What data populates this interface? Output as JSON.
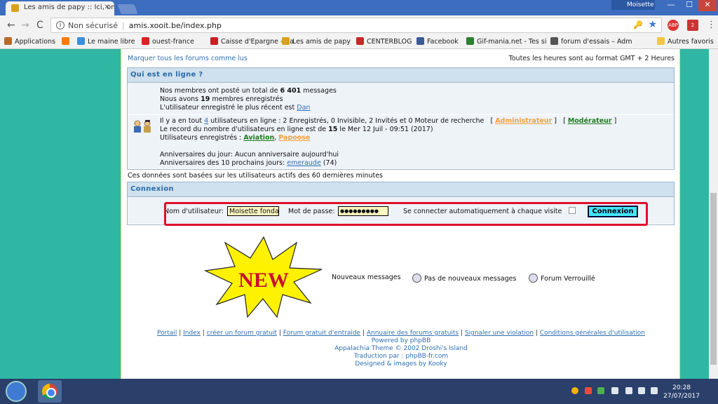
{
  "browser": {
    "tab_title": "Les amis de papy :: Ici, on",
    "tab_close": "✕",
    "profile_name": "Moisette",
    "min_glyph": "—",
    "max_glyph": "☐",
    "close_glyph": "✕",
    "back_glyph": "←",
    "forward_glyph": "→",
    "reload_glyph": "C",
    "security_label": "Non sécurisé",
    "url": "amis.xooit.be/index.php",
    "info_glyph": "i",
    "key_glyph": "🔑",
    "star_glyph": "★",
    "ext1_badge": "ABP",
    "ext2_badge": "2",
    "menu_glyph": "⋮",
    "bookmarks": [
      {
        "label": "Applications",
        "color": "#b86a2a"
      },
      {
        "label": "",
        "color": "#ff7900"
      },
      {
        "label": "Le maine libre",
        "color": "#3a8edc"
      },
      {
        "label": "ouest-france",
        "color": "#d22"
      },
      {
        "label": "Caisse d'Epargne - Ca",
        "color": "#c81d25"
      },
      {
        "label": "Les amis de papy",
        "color": "#d9a21b"
      },
      {
        "label": "CENTERBLOG",
        "color": "#c62828"
      },
      {
        "label": "Facebook",
        "color": "#3b5998"
      },
      {
        "label": "Gif-mania.net - Tes si",
        "color": "#2e7d32"
      },
      {
        "label": "forum d'essais – Adm",
        "color": "#555555"
      }
    ],
    "other_bookmarks": "Autres favoris"
  },
  "forum": {
    "mark_all_read": "Marquer tous les forums comme lus",
    "timezone": "Toutes les heures sont au format GMT + 2 Heures",
    "who_online": {
      "title": "Qui est en ligne ?",
      "stats": {
        "posts_pre": "Nos membres ont posté un total de ",
        "posts_count": "6 401",
        "posts_post": " messages",
        "members_pre": "Nous avons ",
        "members_count": "19",
        "members_post": " membres enregistrés",
        "newest_pre": "L'utilisateur enregistré le plus récent est ",
        "newest_user": "Dan"
      },
      "online": {
        "line1_pre": "Il y a en tout ",
        "line1_count": "4",
        "line1_post": " utilisateurs en ligne : 2 Enregistrés, 0 Invisible, 2 Invités et 0 Moteur de recherche",
        "bracket_open": "[",
        "bracket_close": "]",
        "admin_label": "Administrateur",
        "mod_label": "Modérateur",
        "record_pre": "Le record du nombre d'utilisateurs en ligne est de ",
        "record_count": "15",
        "record_post": " le Mer 12 Juil - 09:51 (2017)",
        "registered_pre": "Utilisateurs enregistrés : ",
        "user1": "Aviation",
        "user_sep": ", ",
        "user2": "Papoose"
      },
      "birthdays": {
        "today": "Anniversaires du jour: Aucun anniversaire aujourd'hui",
        "next_pre": "Anniversaires des 10 prochains jours: ",
        "next_user": "emeraude",
        "next_age": " (74)"
      }
    },
    "data_note": "Ces données sont basées sur les utilisateurs actifs des 60 dernières minutes",
    "login": {
      "title": "Connexion",
      "username_label": "Nom d'utilisateur:",
      "username_value": "Moisette fonda",
      "password_label": "Mot de passe:",
      "password_value": "●●●●●●●●●",
      "auto_login_label": "Se connecter automatiquement à chaque visite",
      "auto_login_checked": false,
      "submit_label": "Connexion"
    },
    "new_badge": "NEW",
    "legend": {
      "new_messages": "Nouveaux messages",
      "no_new_messages": "Pas de nouveaux messages",
      "locked": "Forum Verrouillé"
    },
    "footer": {
      "links": [
        "Portail",
        "Index",
        "créer un forum gratuit",
        "Forum gratuit d'entraide",
        "Annuaire des forums gratuits",
        "Signaler une violation",
        "Conditions générales d'utilisation"
      ],
      "separator": " | ",
      "powered": "Powered by phpBB",
      "theme": "Appalachia Theme © 2002 Droshi's Island",
      "translation": "Traduction par : phpBB-fr.com",
      "designed": "Designed & images by Kooky"
    }
  },
  "taskbar": {
    "time": "20:28",
    "date": "27/07/2017"
  }
}
